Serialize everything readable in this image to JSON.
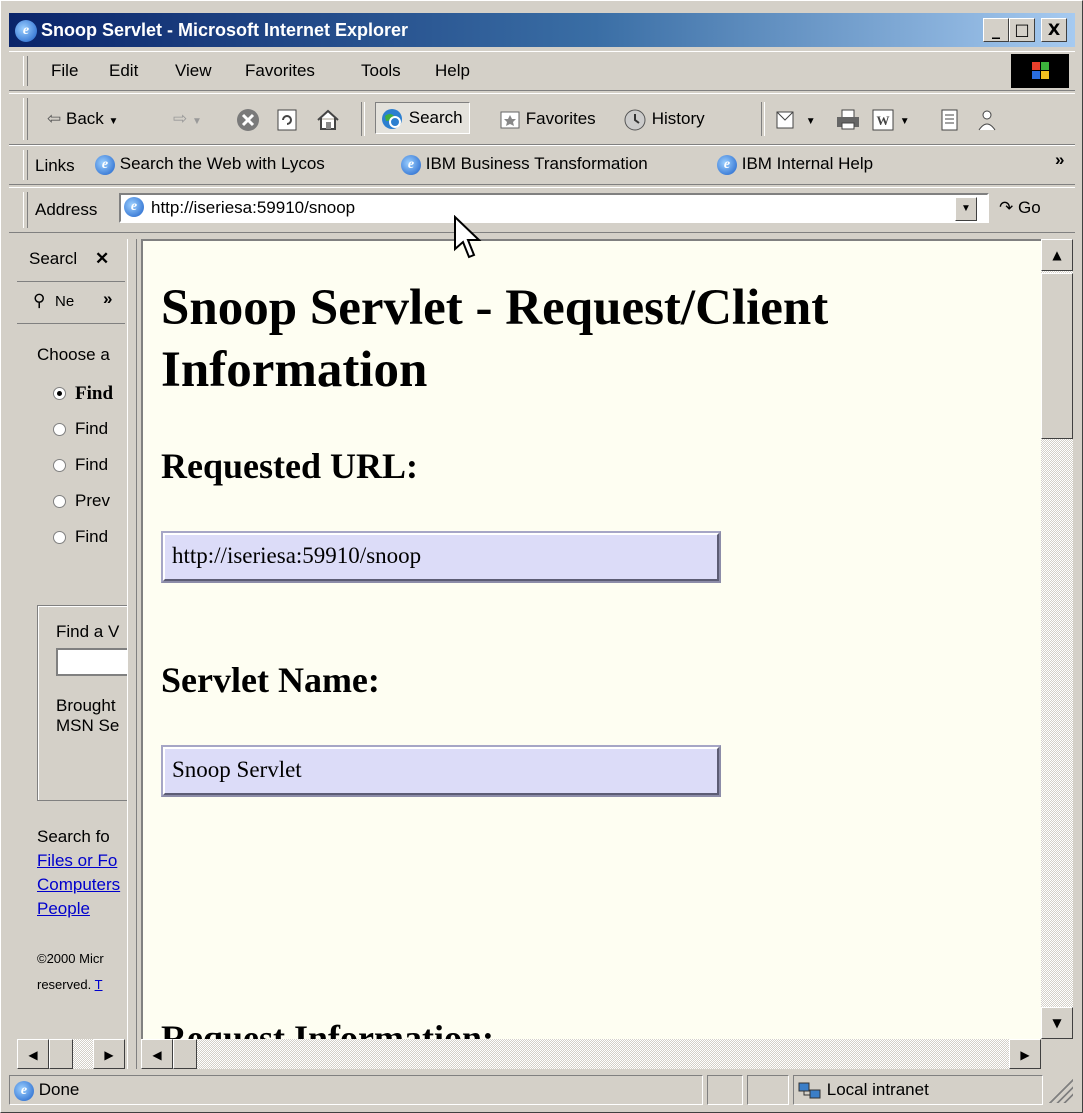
{
  "window": {
    "title": "Snoop Servlet - Microsoft Internet Explorer",
    "minimize": "_",
    "maximize": "□",
    "close": "X"
  },
  "menu": [
    "File",
    "Edit",
    "View",
    "Favorites",
    "Tools",
    "Help"
  ],
  "toolbar": {
    "back": "Back",
    "search": "Search",
    "favorites": "Favorites",
    "history": "History"
  },
  "links_bar": {
    "label": "Links",
    "items": [
      "Search the Web with Lycos",
      "IBM Business Transformation",
      "IBM Internal Help"
    ],
    "more": "»"
  },
  "address": {
    "label": "Address",
    "url": "http://iseriesa:59910/snoop",
    "go": "Go"
  },
  "search_pane": {
    "title": "Searcl",
    "close": "✕",
    "new_button": "Ne",
    "more": "»",
    "choose": "Choose a",
    "options": [
      "Find",
      "Find",
      "Find",
      "Prev",
      "Find"
    ],
    "selected_index": 0,
    "find_box_label": "Find a V",
    "brought": "Brought",
    "msn": "MSN Se",
    "search_for": "Search fo",
    "links": [
      "Files or Fo",
      "Computers",
      "People"
    ],
    "copyright_1": "©2000 Micr",
    "copyright_2": "reserved. ",
    "copyright_link": "T"
  },
  "content": {
    "heading": "Snoop Servlet - Request/Client Information",
    "requested_url_label": "Requested URL:",
    "requested_url": "http://iseriesa:59910/snoop",
    "servlet_name_label": "Servlet Name:",
    "servlet_name": "Snoop Servlet",
    "request_info_label": "Request Information:"
  },
  "status": {
    "text": "Done",
    "zone": "Local intranet"
  }
}
